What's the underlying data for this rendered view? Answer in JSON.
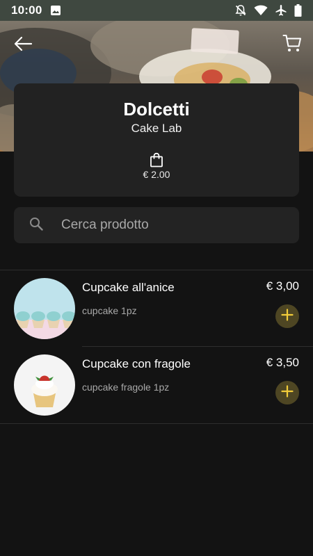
{
  "status_bar": {
    "time": "10:00"
  },
  "shop": {
    "name": "Dolcetti",
    "subtitle": "Cake Lab",
    "min_order": "€ 2.00"
  },
  "search": {
    "placeholder": "Cerca prodotto"
  },
  "products": [
    {
      "name": "Cupcake all'anice",
      "description": "cupcake 1pz",
      "price": "€ 3,00"
    },
    {
      "name": "Cupcake con fragole",
      "description": "cupcake fragole 1pz",
      "price": "€ 3,50"
    }
  ],
  "colors": {
    "accent": "#f2cc3a",
    "add_button_bg": "#4e4623",
    "background": "#131313",
    "card": "#222222"
  },
  "icons": [
    "image-icon",
    "notifications-off-icon",
    "wifi-icon",
    "airplane-icon",
    "battery-icon",
    "back-arrow-icon",
    "cart-icon",
    "shopping-bag-icon",
    "search-icon",
    "plus-icon"
  ]
}
